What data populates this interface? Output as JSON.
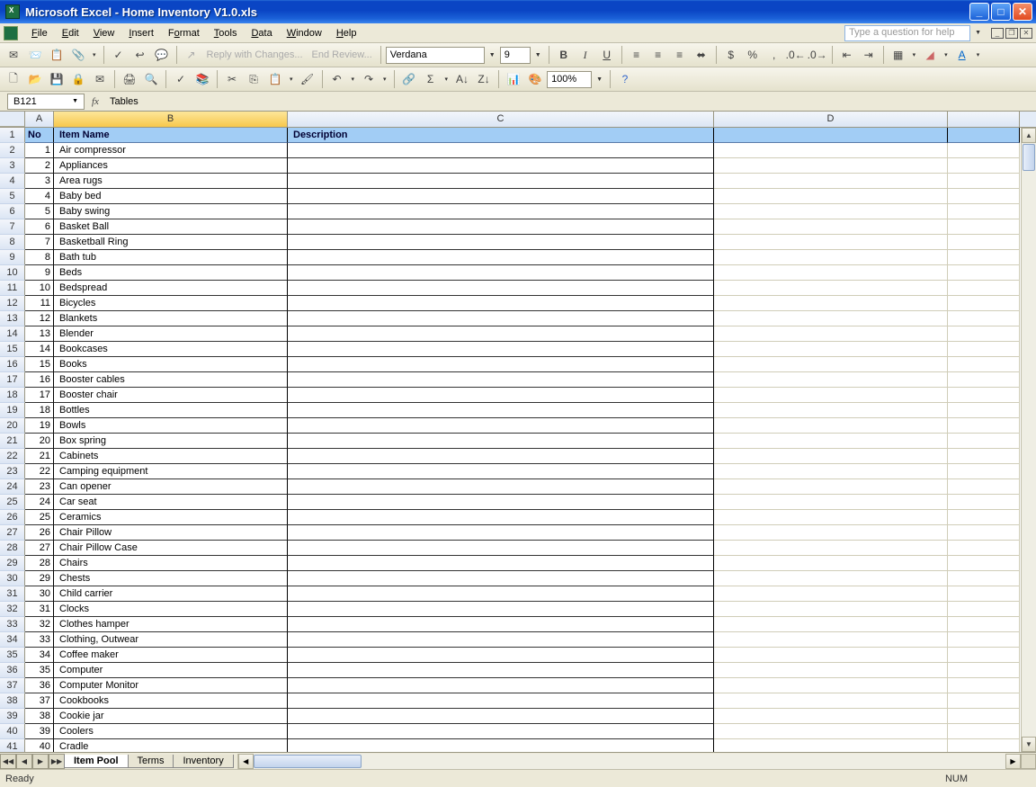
{
  "title": "Microsoft Excel - Home Inventory V1.0.xls",
  "menus": [
    "File",
    "Edit",
    "View",
    "Insert",
    "Format",
    "Tools",
    "Data",
    "Window",
    "Help"
  ],
  "help_placeholder": "Type a question for help",
  "toolbar1": {
    "reply": "Reply with Changes...",
    "end": "End Review...",
    "font_name": "Verdana",
    "font_size": "9"
  },
  "toolbar2": {
    "zoom": "100%"
  },
  "namebox": "B121",
  "formula": "Tables",
  "columns": [
    "A",
    "B",
    "C",
    "D",
    ""
  ],
  "headers": {
    "A": "No",
    "B": "Item Name",
    "C": "Description"
  },
  "items": [
    "Air compressor",
    "Appliances",
    "Area rugs",
    "Baby bed",
    "Baby swing",
    "Basket Ball",
    "Basketball Ring",
    "Bath tub",
    "Beds",
    "Bedspread",
    "Bicycles",
    "Blankets",
    "Blender",
    "Bookcases",
    "Books",
    "Booster cables",
    "Booster chair",
    "Bottles",
    "Bowls",
    "Box spring",
    "Cabinets",
    "Camping equipment",
    "Can opener",
    "Car seat",
    "Ceramics",
    "Chair Pillow",
    "Chair Pillow Case",
    "Chairs",
    "Chests",
    "Child carrier",
    "Clocks",
    "Clothes hamper",
    "Clothing, Outwear",
    "Coffee maker",
    "Computer",
    "Computer Monitor",
    "Cookbooks",
    "Cookie jar",
    "Coolers",
    "Cradle"
  ],
  "sheet_tabs": [
    "Item Pool",
    "Terms",
    "Inventory"
  ],
  "status": "Ready",
  "num": "NUM"
}
